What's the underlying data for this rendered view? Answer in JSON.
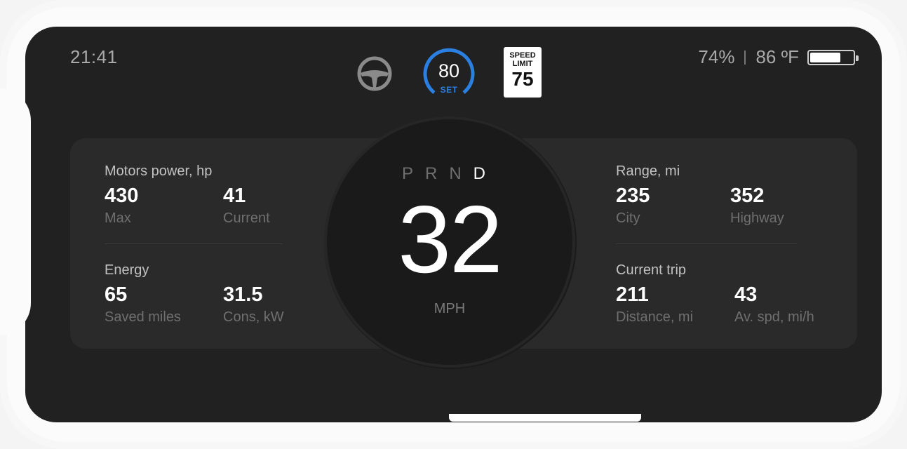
{
  "status": {
    "time": "21:41",
    "battery_percent_label": "74%",
    "battery_level": 0.74,
    "temperature": "86 ºF"
  },
  "icons": {
    "steering": "steering-wheel-icon",
    "battery": "battery-icon"
  },
  "cruise": {
    "speed": "80",
    "label": "SET",
    "accent_color": "#2b7fe0"
  },
  "speed_limit": {
    "line1": "SPEED",
    "line2": "LIMIT",
    "value": "75"
  },
  "gauge": {
    "gears": [
      "P",
      "R",
      "N",
      "D"
    ],
    "active_gear": "D",
    "speed": "32",
    "unit": "MPH"
  },
  "motors": {
    "title": "Motors power, hp",
    "max_value": "430",
    "max_label": "Max",
    "current_value": "41",
    "current_label": "Current"
  },
  "energy": {
    "title": "Energy",
    "saved_value": "65",
    "saved_label": "Saved miles",
    "cons_value": "31.5",
    "cons_label": "Cons, kW"
  },
  "range": {
    "title": "Range, mi",
    "city_value": "235",
    "city_label": "City",
    "highway_value": "352",
    "highway_label": "Highway"
  },
  "trip": {
    "title": "Current trip",
    "distance_value": "211",
    "distance_label": "Distance, mi",
    "avg_value": "43",
    "avg_label": "Av. spd, mi/h"
  }
}
